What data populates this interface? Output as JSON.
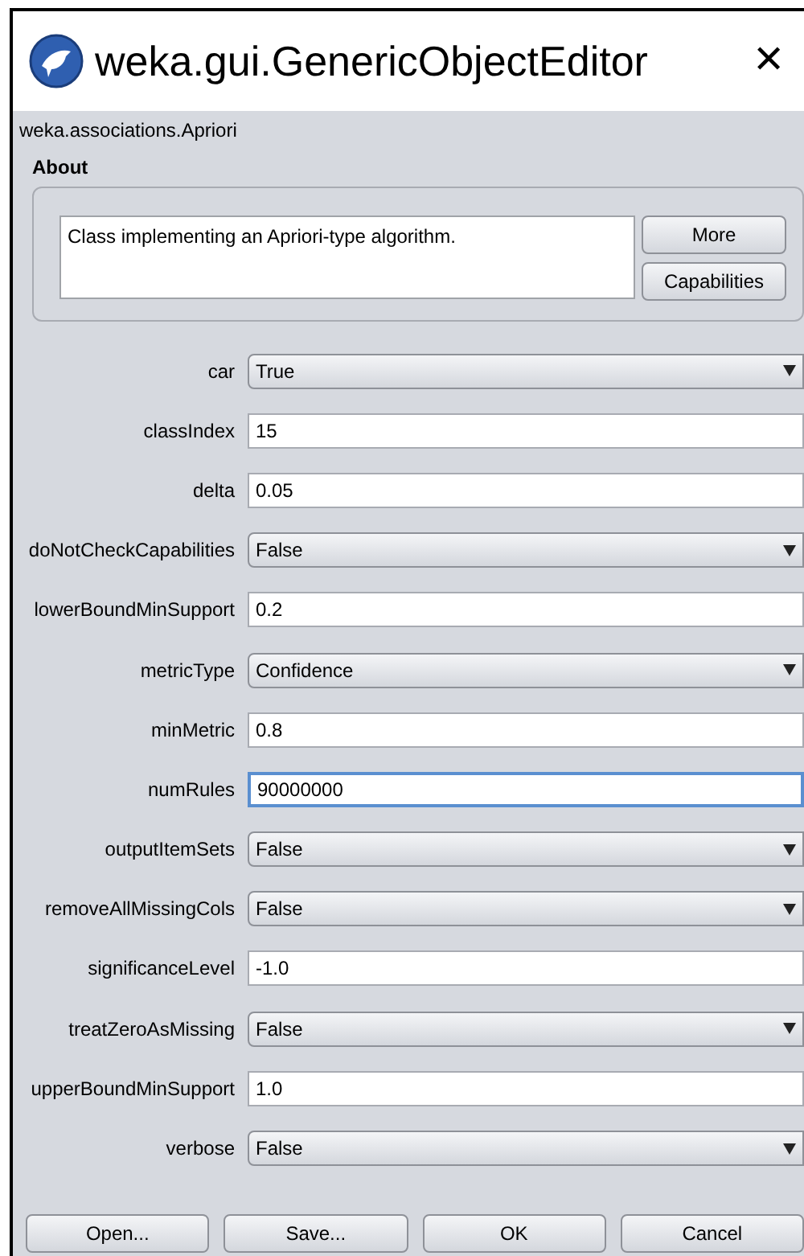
{
  "window": {
    "title": "weka.gui.GenericObjectEditor",
    "close": "✕"
  },
  "class_name": "weka.associations.Apriori",
  "about": {
    "heading": "About",
    "text": "Class implementing an Apriori-type algorithm.",
    "buttons": [
      "More",
      "Capabilities"
    ]
  },
  "properties": [
    {
      "label": "car",
      "kind": "dropdown",
      "value": "True",
      "focused": false
    },
    {
      "label": "classIndex",
      "kind": "text",
      "value": "15",
      "focused": false
    },
    {
      "label": "delta",
      "kind": "text",
      "value": "0.05",
      "focused": false
    },
    {
      "label": "doNotCheckCapabilities",
      "kind": "dropdown",
      "value": "False",
      "focused": false
    },
    {
      "label": "lowerBoundMinSupport",
      "kind": "text",
      "value": "0.2",
      "focused": false
    },
    {
      "label": "metricType",
      "kind": "dropdown",
      "value": "Confidence",
      "focused": false
    },
    {
      "label": "minMetric",
      "kind": "text",
      "value": "0.8",
      "focused": false
    },
    {
      "label": "numRules",
      "kind": "text",
      "value": "90000000",
      "focused": true
    },
    {
      "label": "outputItemSets",
      "kind": "dropdown",
      "value": "False",
      "focused": false
    },
    {
      "label": "removeAllMissingCols",
      "kind": "dropdown",
      "value": "False",
      "focused": false
    },
    {
      "label": "significanceLevel",
      "kind": "text",
      "value": "-1.0",
      "focused": false
    },
    {
      "label": "treatZeroAsMissing",
      "kind": "dropdown",
      "value": "False",
      "focused": false
    },
    {
      "label": "upperBoundMinSupport",
      "kind": "text",
      "value": "1.0",
      "focused": false
    },
    {
      "label": "verbose",
      "kind": "dropdown",
      "value": "False",
      "focused": false
    }
  ],
  "buttons": [
    "Open...",
    "Save...",
    "OK",
    "Cancel"
  ]
}
